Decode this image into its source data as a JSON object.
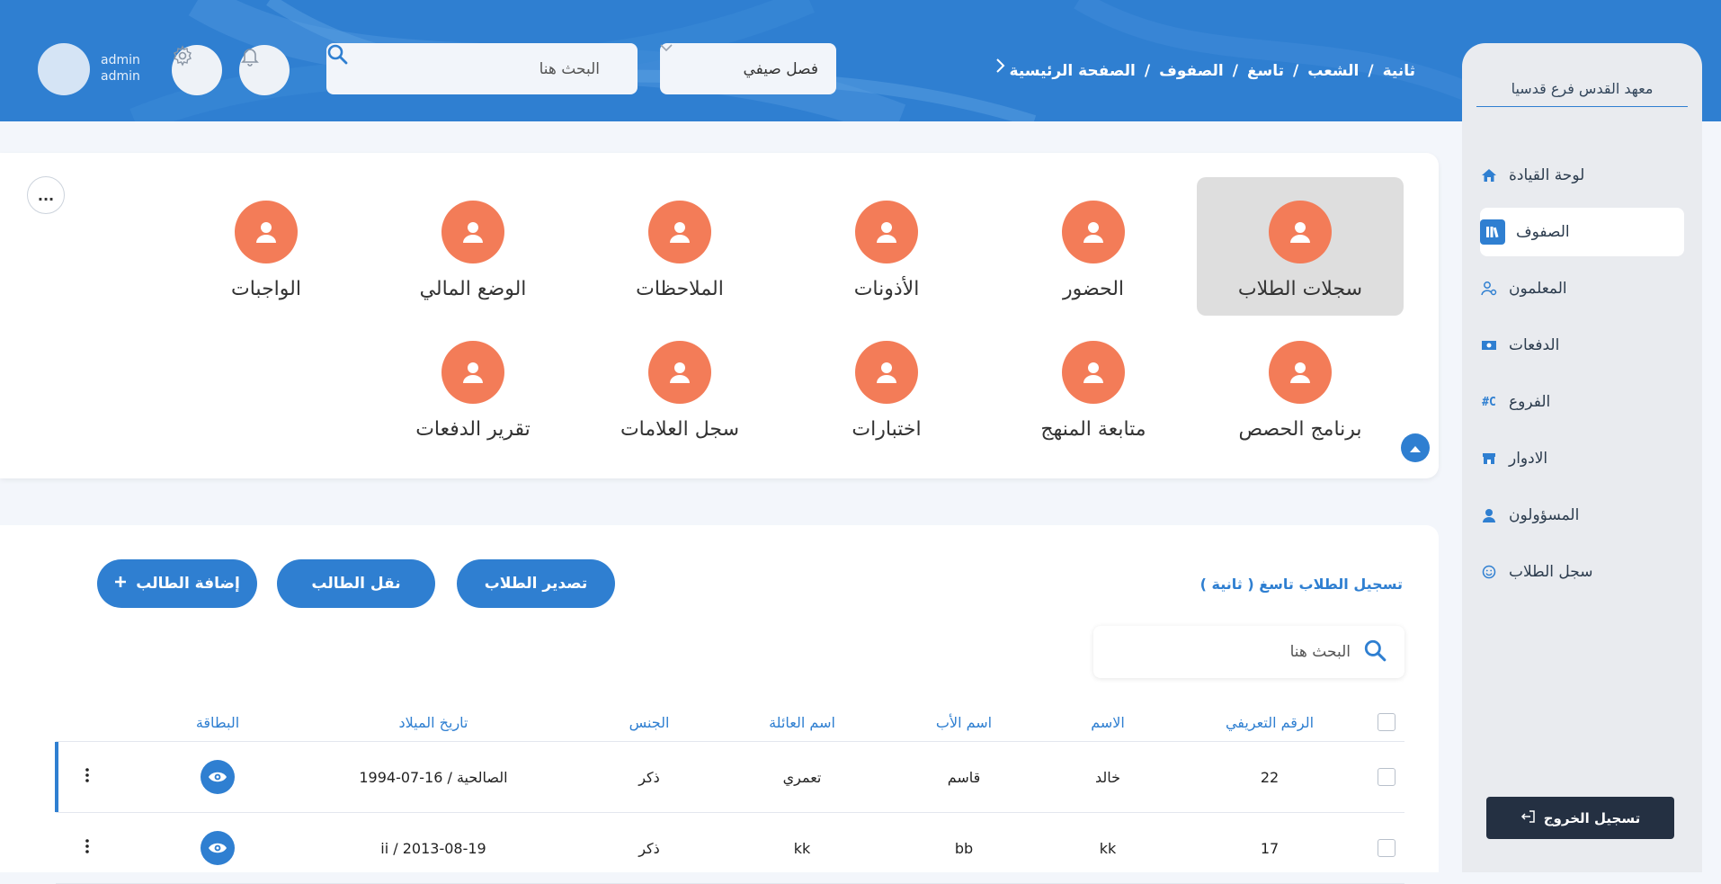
{
  "header": {
    "breadcrumb": [
      "الصفحة الرئيسية",
      "/",
      "الصفوف",
      "/",
      "تاسغ",
      "/",
      "الشعب",
      "/",
      "ثانية"
    ],
    "season": "فصل صيفي",
    "search_placeholder": "البحث هنا",
    "user": {
      "name": "admin",
      "role": "admin"
    },
    "icons": {
      "settings": "gear-icon",
      "notifications": "bell-icon",
      "search": "search-icon",
      "back": "chevron-right-icon"
    }
  },
  "sidebar": {
    "institute": "معهد القدس فرع قدسيا",
    "items": [
      {
        "label": "لوحة القيادة",
        "icon": "home-icon",
        "active": false
      },
      {
        "label": "الصفوف",
        "icon": "books-icon",
        "active": true
      },
      {
        "label": "المعلمون",
        "icon": "teacher-icon",
        "active": false
      },
      {
        "label": "الدفعات",
        "icon": "money-icon",
        "active": false
      },
      {
        "label": "الفروع",
        "icon": "code-branch-icon",
        "active": false
      },
      {
        "label": "الادوار",
        "icon": "store-icon",
        "active": false
      },
      {
        "label": "المسؤولون",
        "icon": "user-icon",
        "active": false
      },
      {
        "label": "سجل الطلاب",
        "icon": "smile-icon",
        "active": false
      }
    ],
    "logout": "تسجيل الخروج"
  },
  "modules": {
    "row1": [
      "سجلات الطلاب",
      "الحضور",
      "الأذونات",
      "الملاحظات",
      "الوضع المالي",
      "الواجبات"
    ],
    "row2": [
      "برنامج الحصص",
      "متابعة المنهج",
      "اختبارات",
      "سجل العلامات",
      "تقرير الدفعات"
    ],
    "selected": "سجلات الطلاب",
    "more": "..."
  },
  "students": {
    "title": "تسجيل الطلاب تاسغ ( ثانية )",
    "buttons": {
      "export": "تصدير الطلاب",
      "transfer": "نقل الطالب",
      "add": "إضافة الطالب"
    },
    "search_placeholder": "البحث هنا",
    "columns": [
      "الرقم التعريفي",
      "الاسم",
      "اسم الأب",
      "اسم العائلة",
      "الجنس",
      "تاريخ الميلاد",
      "البطاقة"
    ],
    "rows": [
      {
        "id": "22",
        "name": "خالد",
        "father": "قاسم",
        "family": "تعمري",
        "gender": "ذكر",
        "birth": "الصالحية / 16-07-1994"
      },
      {
        "id": "17",
        "name": "kk",
        "father": "bb",
        "family": "kk",
        "gender": "ذكر",
        "birth": "ii / 2013-08-19"
      }
    ]
  },
  "colors": {
    "primary": "#2f7fd1",
    "accent": "#f37c58",
    "sidebar": "#e9ebef",
    "logout": "#243042"
  }
}
